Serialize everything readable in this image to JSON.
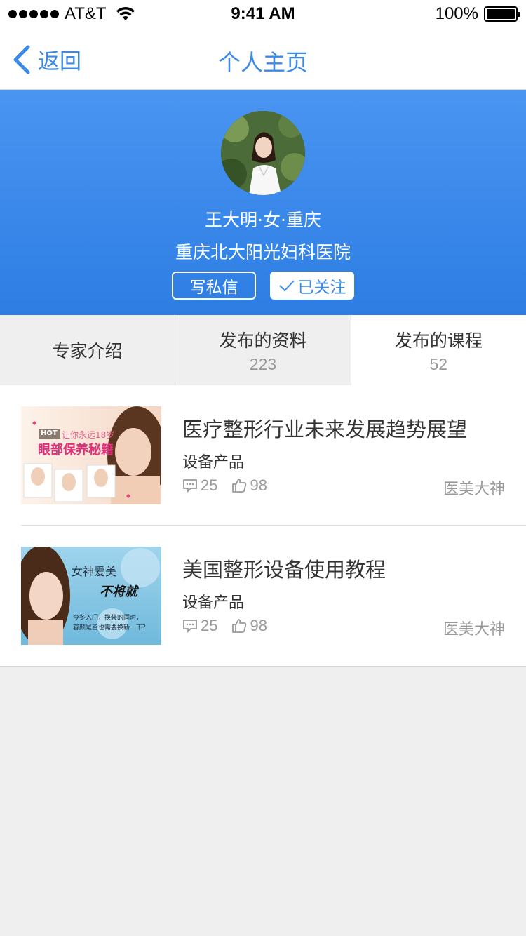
{
  "status_bar": {
    "carrier": "AT&T",
    "time": "9:41 AM",
    "battery": "100%"
  },
  "nav": {
    "back_label": "返回",
    "title": "个人主页"
  },
  "profile": {
    "name_line": "王大明·女·重庆",
    "hospital": "重庆北大阳光妇科医院",
    "message_button": "写私信",
    "follow_button": "已关注"
  },
  "tabs": [
    {
      "label": "专家介绍",
      "count": ""
    },
    {
      "label": "发布的资料",
      "count": "223"
    },
    {
      "label": "发布的课程",
      "count": "52"
    }
  ],
  "items": [
    {
      "title": "医疗整形行业未来发展趋势展望",
      "category": "设备产品",
      "comments": "25",
      "likes": "98",
      "author": "医美大神",
      "thumb": {
        "badge": "HOT",
        "line1": "让你永远18岁",
        "line2": "眼部保养秘籍"
      }
    },
    {
      "title": "美国整形设备使用教程",
      "category": "设备产品",
      "comments": "25",
      "likes": "98",
      "author": "医美大神",
      "thumb": {
        "line1": "女神爱美",
        "line2": "不将就",
        "line3": "今冬入门，换装的同时，",
        "line4": "容颜是否也需要换新一下？"
      }
    }
  ],
  "colors": {
    "accent": "#3c8ae8",
    "header_top": "#4a95f2",
    "header_bottom": "#2d7de3",
    "background": "#efefef"
  }
}
